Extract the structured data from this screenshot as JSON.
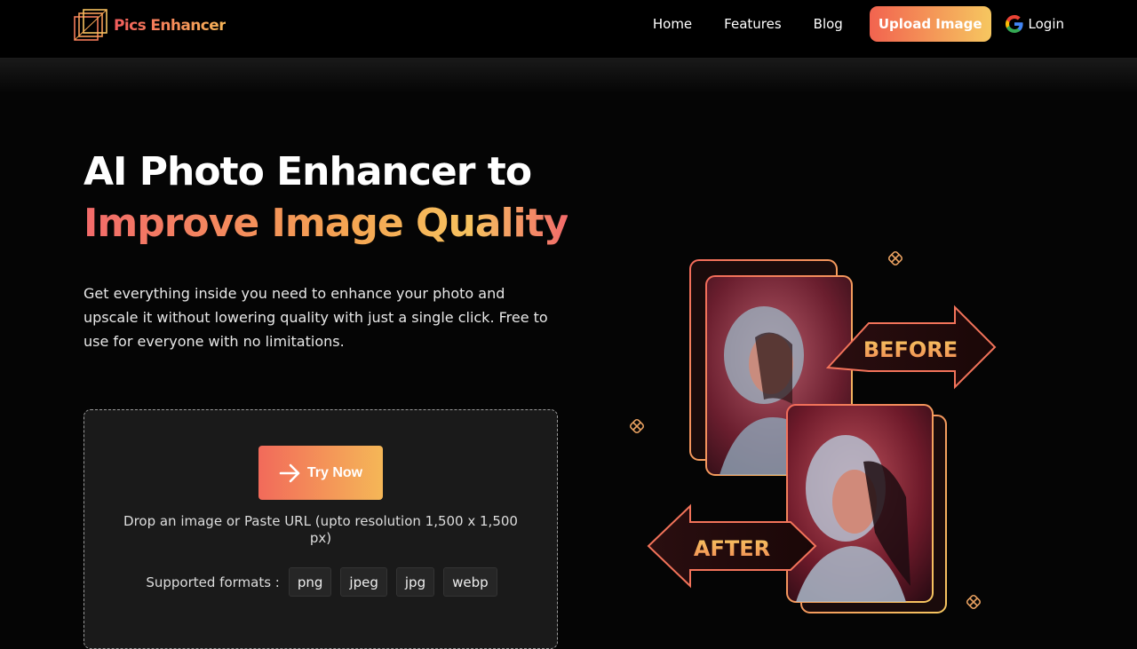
{
  "header": {
    "brand": "Pics Enhancer",
    "nav": [
      {
        "label": "Home"
      },
      {
        "label": "Features"
      },
      {
        "label": "Blog"
      }
    ],
    "upload_label": "Upload Image",
    "login_label": "Login"
  },
  "hero": {
    "title_line1": "AI Photo Enhancer to",
    "title_line2": "Improve Image Quality",
    "description": "Get everything inside you need to enhance your photo and upscale it without lowering quality with just a single click. Free to use for everyone with no limitations."
  },
  "upload_box": {
    "try_label": "Try Now",
    "drop_text": "Drop an image or Paste URL (upto resolution 1,500 x 1,500 px)",
    "formats_label": "Supported formats :",
    "formats": [
      "png",
      "jpeg",
      "jpg",
      "webp"
    ]
  },
  "illustration": {
    "before_label": "BEFORE",
    "after_label": "AFTER"
  },
  "colors": {
    "accent_start": "#f2634f",
    "accent_end": "#f6c760",
    "background": "#050505"
  }
}
